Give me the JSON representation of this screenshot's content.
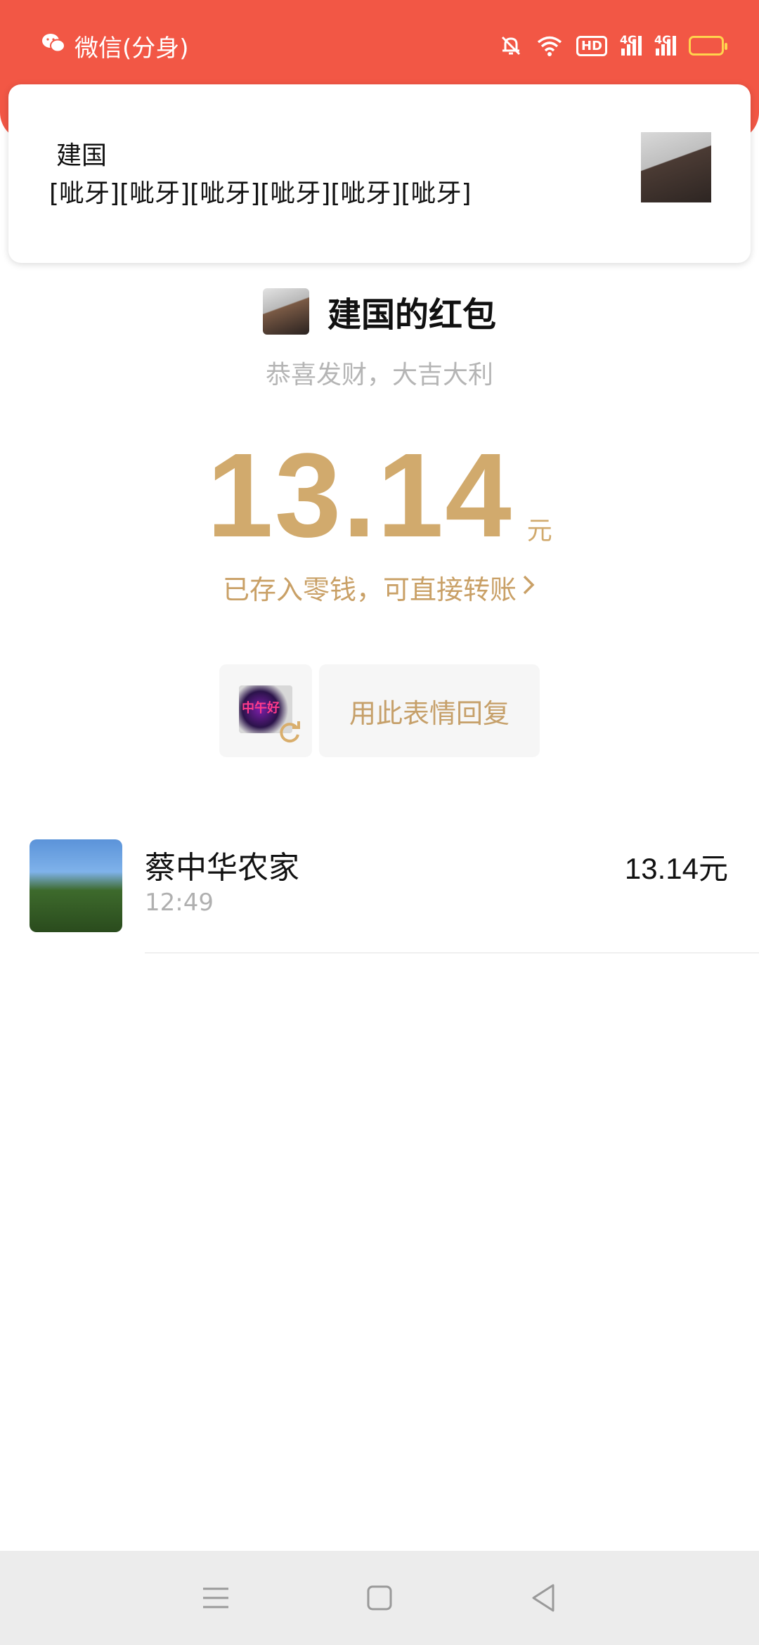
{
  "status_bar": {
    "app_label": "微信(分身)",
    "hd_badge": "HD",
    "network_1": "4G",
    "network_2": "4G",
    "colors": {
      "header": "#f25745",
      "battery": "#ffc21a"
    }
  },
  "notification": {
    "title": "建国",
    "body": "[呲牙][呲牙][呲牙][呲牙][呲牙][呲牙]"
  },
  "red_packet": {
    "sender_title": "建国的红包",
    "greeting": "恭喜发财，大吉大利",
    "amount": "13.14",
    "unit": "元",
    "saved_text": "已存入零钱，可直接转账",
    "accent_color": "#d1aa6d"
  },
  "reply": {
    "sticker_text": "中午好",
    "button_label": "用此表情回复"
  },
  "receivers": [
    {
      "name": "蔡中华农家",
      "time": "12:49",
      "amount": "13.14元"
    }
  ]
}
